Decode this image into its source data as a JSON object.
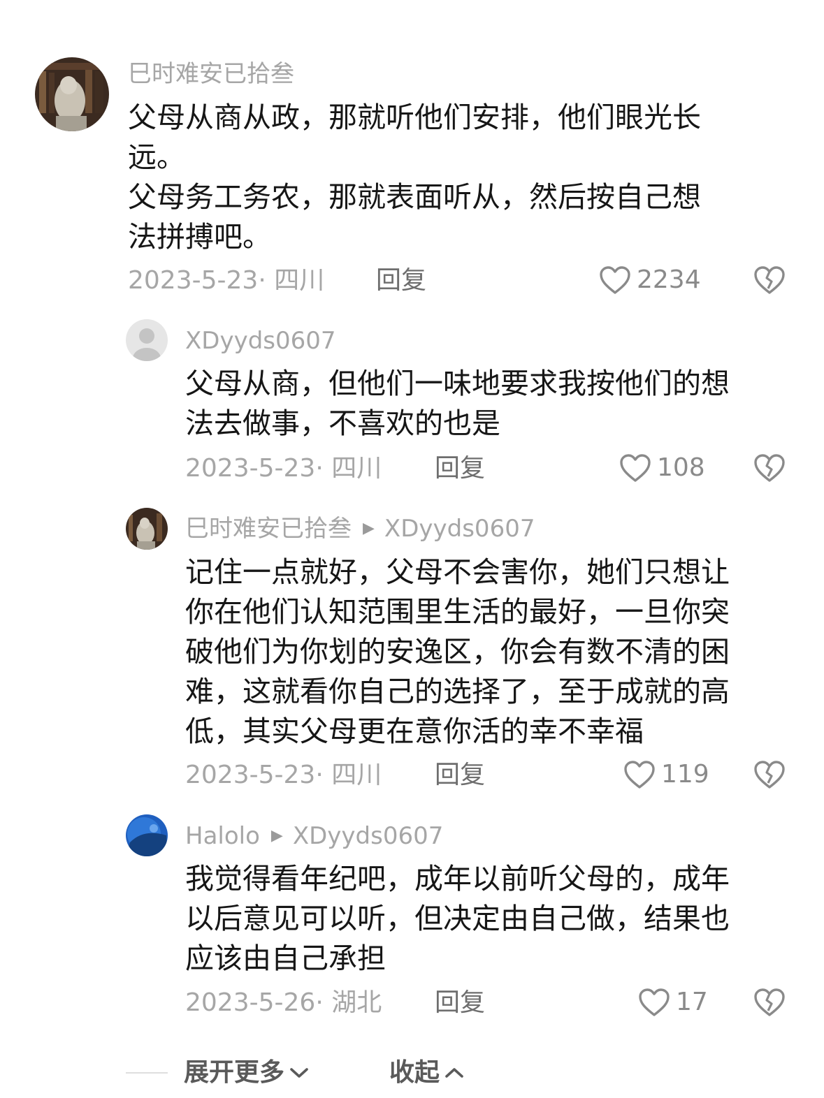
{
  "comments": [
    {
      "author": "巳时难安已拾叁",
      "reply_to": "",
      "lines": [
        "父母从商从政，那就听他们安排，他们眼光长",
        "远。",
        "父母务工务农，那就表面听从，然后按自己想",
        "法拼搏吧。"
      ],
      "date": "2023-5-23",
      "location": "四川",
      "reply_label": "回复",
      "likes": "2234"
    },
    {
      "author": "XDyyds0607",
      "reply_to": "",
      "lines": [
        "父母从商，但他们一味地要求我按他们的想",
        "法去做事，不喜欢的也是"
      ],
      "date": "2023-5-23",
      "location": "四川",
      "reply_label": "回复",
      "likes": "108"
    },
    {
      "author": "巳时难安已拾叁",
      "reply_to": "XDyyds0607",
      "lines": [
        "记住一点就好，父母不会害你，她们只想让",
        "你在他们认知范围里生活的最好，一旦你突",
        "破他们为你划的安逸区，你会有数不清的困",
        "难，这就看你自己的选择了，至于成就的高",
        "低，其实父母更在意你活的幸不幸福"
      ],
      "date": "2023-5-23",
      "location": "四川",
      "reply_label": "回复",
      "likes": "119"
    },
    {
      "author": "Halolo",
      "reply_to": "XDyyds0607",
      "lines": [
        "我觉得看年纪吧，成年以前听父母的，成年",
        "以后意见可以听，但决定由自己做，结果也",
        "应该由自己承担"
      ],
      "date": "2023-5-26",
      "location": "湖北",
      "reply_label": "回复",
      "likes": "17"
    }
  ],
  "footer": {
    "expand_label": "展开更多",
    "collapse_label": "收起"
  },
  "icons": {
    "like": "heart-outline-icon",
    "dislike": "broken-heart-icon",
    "expand": "chevron-down-icon",
    "collapse": "chevron-up-icon",
    "reply_arrow": "triangle-right-icon"
  },
  "colors": {
    "secondary_text": "#a6a6a6",
    "body_text": "#161616",
    "icon": "#8a8a8a"
  }
}
